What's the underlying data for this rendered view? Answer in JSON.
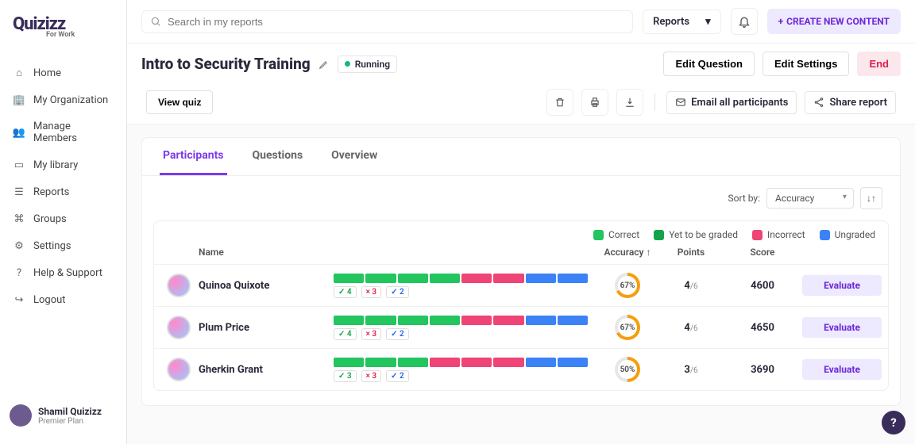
{
  "brand": {
    "name": "Quizizz",
    "sub": "For Work"
  },
  "search": {
    "placeholder": "Search in my reports"
  },
  "reports_dd": "Reports",
  "create_btn": "CREATE NEW CONTENT",
  "nav": [
    {
      "label": "Home"
    },
    {
      "label": "My Organization"
    },
    {
      "label": "Manage Members"
    },
    {
      "label": "My library"
    },
    {
      "label": "Reports"
    },
    {
      "label": "Groups"
    },
    {
      "label": "Settings"
    },
    {
      "label": "Help & Support"
    },
    {
      "label": "Logout"
    }
  ],
  "user": {
    "name": "Shamil Quizizz",
    "plan": "Premier Plan"
  },
  "page": {
    "title": "Intro to Security Training",
    "status": "Running",
    "edit_q": "Edit Question",
    "edit_s": "Edit Settings",
    "end": "End",
    "view_quiz": "View quiz",
    "email_all": "Email all participants",
    "share": "Share report"
  },
  "tabs": {
    "participants": "Participants",
    "questions": "Questions",
    "overview": "Overview"
  },
  "sort": {
    "label": "Sort by:",
    "value": "Accuracy"
  },
  "legend": {
    "correct": "Correct",
    "yet": "Yet to be graded",
    "incorrect": "Incorrect",
    "ungraded": "Ungraded"
  },
  "columns": {
    "name": "Name",
    "accuracy": "Accuracy ↑",
    "points": "Points",
    "score": "Score"
  },
  "eval_label": "Evaluate",
  "rows": [
    {
      "name": "Quinoa Quixote",
      "segments": [
        "g",
        "g",
        "g",
        "g",
        "r",
        "r",
        "b",
        "b"
      ],
      "chips": [
        {
          "t": "g",
          "v": "4"
        },
        {
          "t": "r",
          "v": "3"
        },
        {
          "t": "b",
          "v": "2"
        }
      ],
      "accuracy": "67%",
      "acc_deg": 241,
      "points": "4",
      "points_total": "/6",
      "score": "4600"
    },
    {
      "name": "Plum Price",
      "segments": [
        "g",
        "g",
        "g",
        "g",
        "r",
        "r",
        "b",
        "b"
      ],
      "chips": [
        {
          "t": "g",
          "v": "4"
        },
        {
          "t": "r",
          "v": "3"
        },
        {
          "t": "b",
          "v": "2"
        }
      ],
      "accuracy": "67%",
      "acc_deg": 241,
      "points": "4",
      "points_total": "/6",
      "score": "4650"
    },
    {
      "name": "Gherkin Grant",
      "segments": [
        "g",
        "g",
        "g",
        "r",
        "r",
        "r",
        "b",
        "b"
      ],
      "chips": [
        {
          "t": "g",
          "v": "3"
        },
        {
          "t": "r",
          "v": "3"
        },
        {
          "t": "b",
          "v": "2"
        }
      ],
      "accuracy": "50%",
      "acc_deg": 180,
      "points": "3",
      "points_total": "/6",
      "score": "3690"
    }
  ],
  "colors": {
    "g": "#22c55e",
    "r": "#ef4476",
    "b": "#3b82f6",
    "ring_fg": "#f59e0b",
    "ring_bg": "#e5e7eb"
  }
}
